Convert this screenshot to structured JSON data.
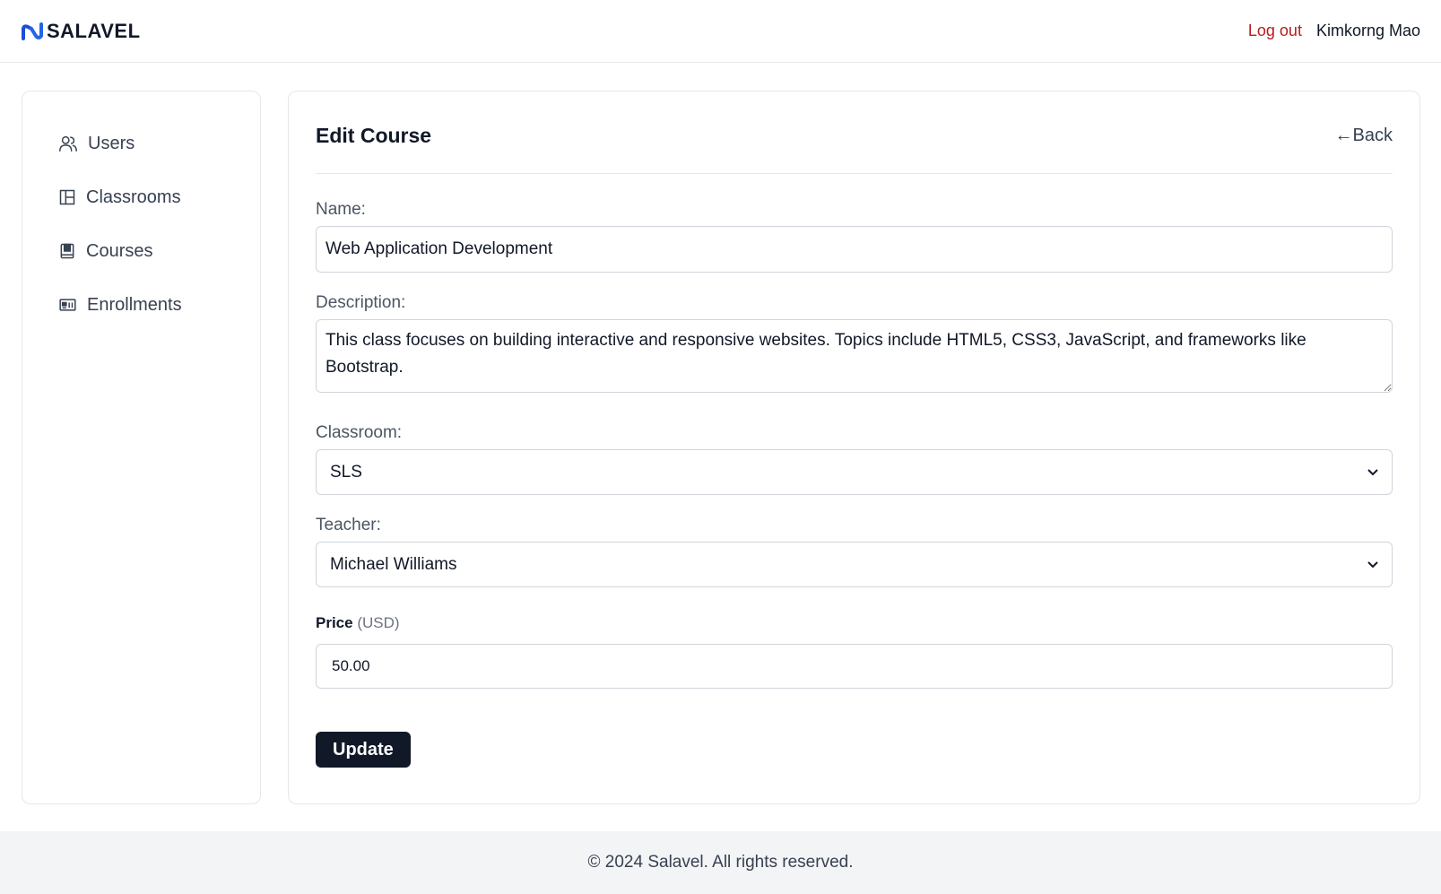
{
  "header": {
    "brand": "SALAVEL",
    "logout_label": "Log out",
    "user_name": "Kimkorng Mao"
  },
  "sidebar": {
    "items": [
      {
        "label": "Users",
        "icon": "users-icon"
      },
      {
        "label": "Classrooms",
        "icon": "layout-icon"
      },
      {
        "label": "Courses",
        "icon": "book-icon"
      },
      {
        "label": "Enrollments",
        "icon": "id-card-icon"
      }
    ]
  },
  "main": {
    "title": "Edit Course",
    "back_label": "←Back",
    "form": {
      "name_label": "Name:",
      "name_value": "Web Application Development",
      "description_label": "Description:",
      "description_value": "This class focuses on building interactive and responsive websites. Topics include HTML5, CSS3, JavaScript, and frameworks like Bootstrap.",
      "classroom_label": "Classroom:",
      "classroom_value": "SLS",
      "teacher_label": "Teacher:",
      "teacher_value": "Michael Williams",
      "price_label": "Price",
      "price_unit": "(USD)",
      "price_value": "50.00",
      "submit_label": "Update"
    }
  },
  "footer": {
    "text": "© 2024 Salavel. All rights reserved."
  },
  "colors": {
    "brand_blue": "#1d4ed8",
    "logout_red": "#b91c1c",
    "button_dark": "#111827"
  }
}
